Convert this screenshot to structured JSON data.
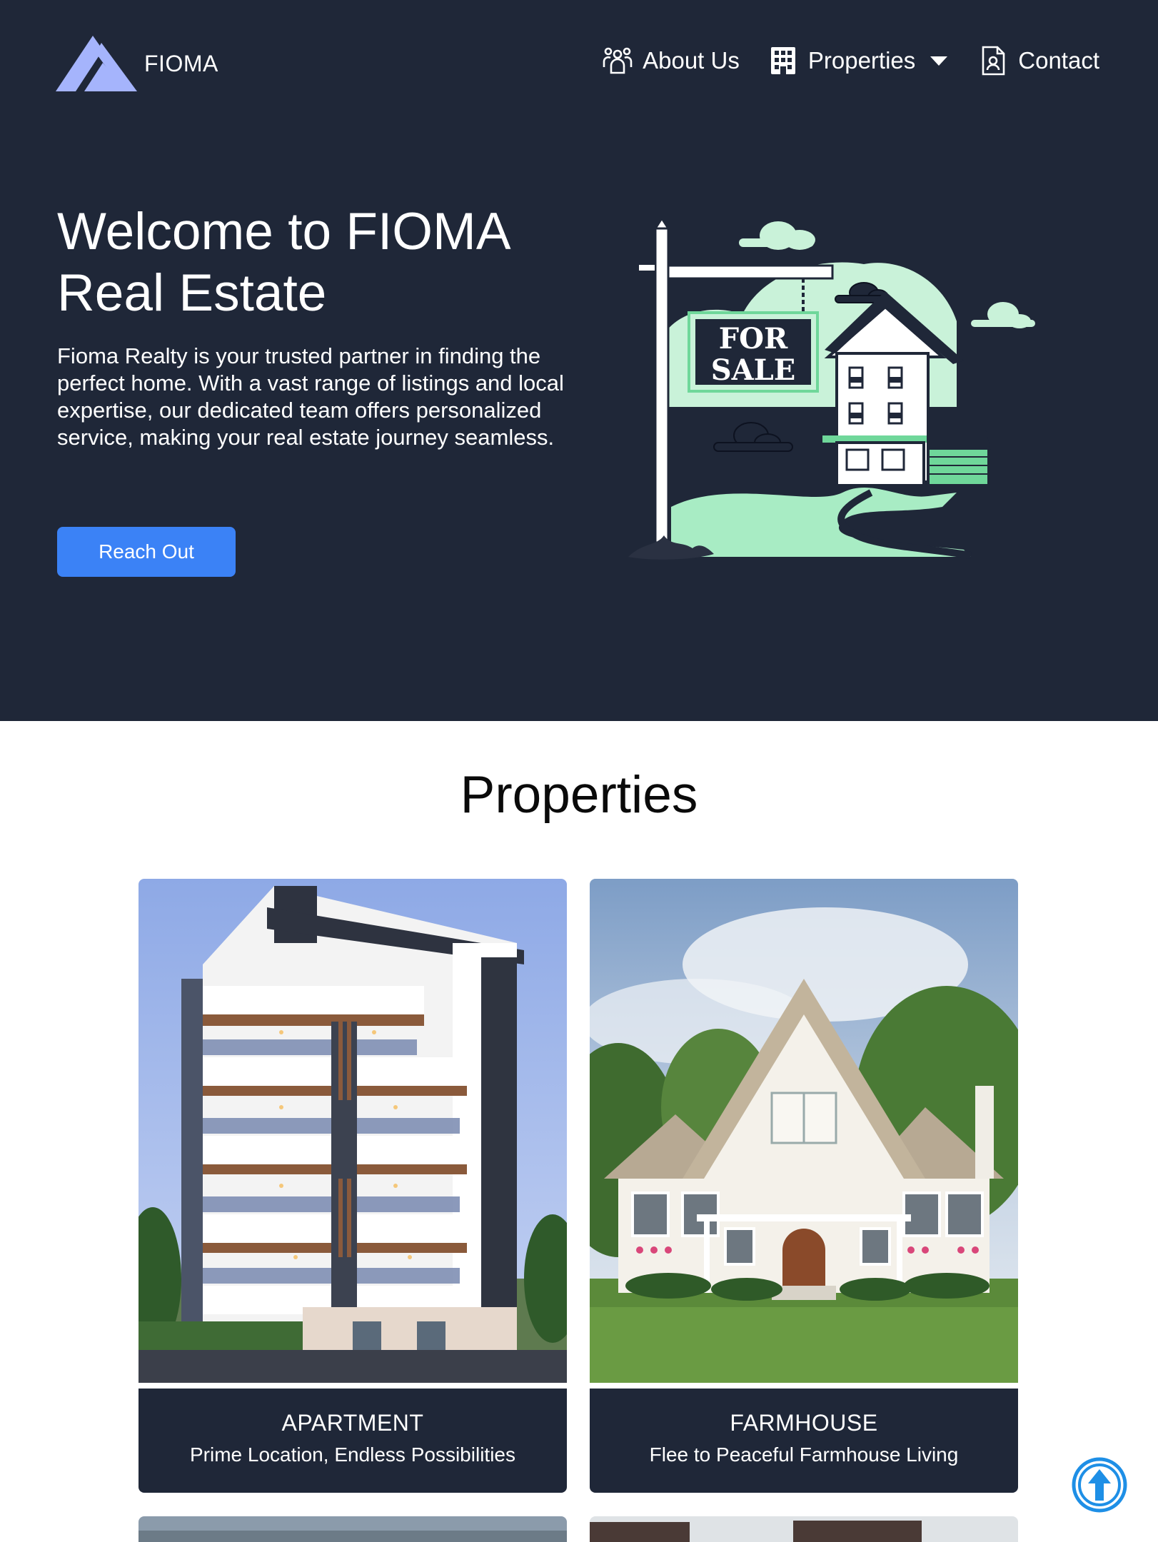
{
  "header": {
    "logo_text": "FIOMA",
    "nav": [
      {
        "label": "About Us",
        "icon": "users-icon"
      },
      {
        "label": "Properties",
        "icon": "building-icon",
        "has_dropdown": true
      },
      {
        "label": "Contact",
        "icon": "contact-card-icon"
      }
    ]
  },
  "hero": {
    "title": "Welcome to FIOMA Real Estate",
    "description": "Fioma Realty is your trusted partner in finding the perfect home. With a vast range of listings and local expertise, our dedicated team offers personalized service, making your real estate journey seamless.",
    "cta_label": "Reach Out",
    "sign_line1": "FOR",
    "sign_line2": "SALE"
  },
  "properties": {
    "title": "Properties",
    "cards": [
      {
        "title": "APARTMENT",
        "subtitle": "Prime Location, Endless Possibilities"
      },
      {
        "title": "FARMHOUSE",
        "subtitle": "Flee to Peaceful Farmhouse Living"
      }
    ]
  },
  "colors": {
    "navy": "#1f2738",
    "accent_blue": "#3b82f6",
    "logo": "#a5b4fc",
    "mint": "#c9f2d9",
    "scroll_button": "#1e8fe6"
  }
}
